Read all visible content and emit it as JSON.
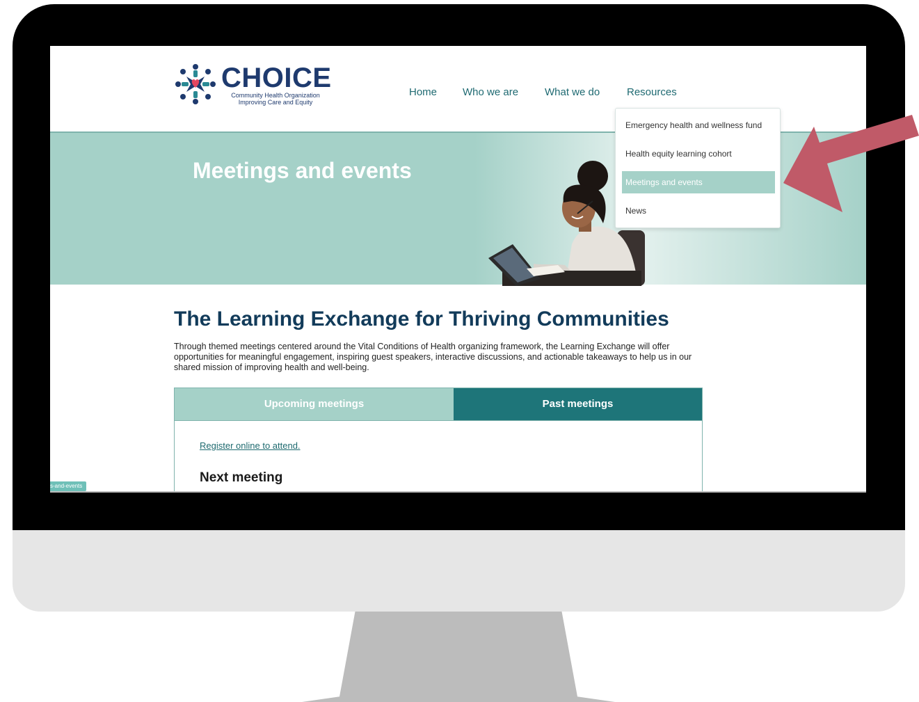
{
  "site": {
    "logo_name": "CHOICE",
    "logo_tagline_line1": "Community Health Organization",
    "logo_tagline_line2": "Improving Care and Equity"
  },
  "nav": {
    "items": [
      {
        "label": "Home"
      },
      {
        "label": "Who we are"
      },
      {
        "label": "What we do"
      },
      {
        "label": "Resources"
      }
    ]
  },
  "dropdown": {
    "items": [
      {
        "label": "Emergency health and wellness fund",
        "active": false
      },
      {
        "label": "Health equity learning cohort",
        "active": false
      },
      {
        "label": "Meetings and events",
        "active": true
      },
      {
        "label": "News",
        "active": false
      }
    ]
  },
  "hero": {
    "title": "Meetings and events"
  },
  "main": {
    "title": "The Learning Exchange for Thriving Communities",
    "intro": "Through themed meetings centered around the Vital Conditions of Health organizing framework, the Learning Exchange will offer opportunities for meaningful engagement, inspiring guest speakers, interactive discussions, and actionable takeaways to help us in our shared mission of improving health and well-being.",
    "tabs": [
      {
        "label": "Upcoming meetings"
      },
      {
        "label": "Past meetings"
      }
    ],
    "register_link": "Register online to attend.",
    "next_meeting_heading": "Next meeting"
  },
  "url_tag": "s-and-events",
  "colors": {
    "teal_light": "#a5d1c8",
    "teal_dark": "#1e7579",
    "navy": "#1e3a6e",
    "arrow": "#c05a68"
  }
}
